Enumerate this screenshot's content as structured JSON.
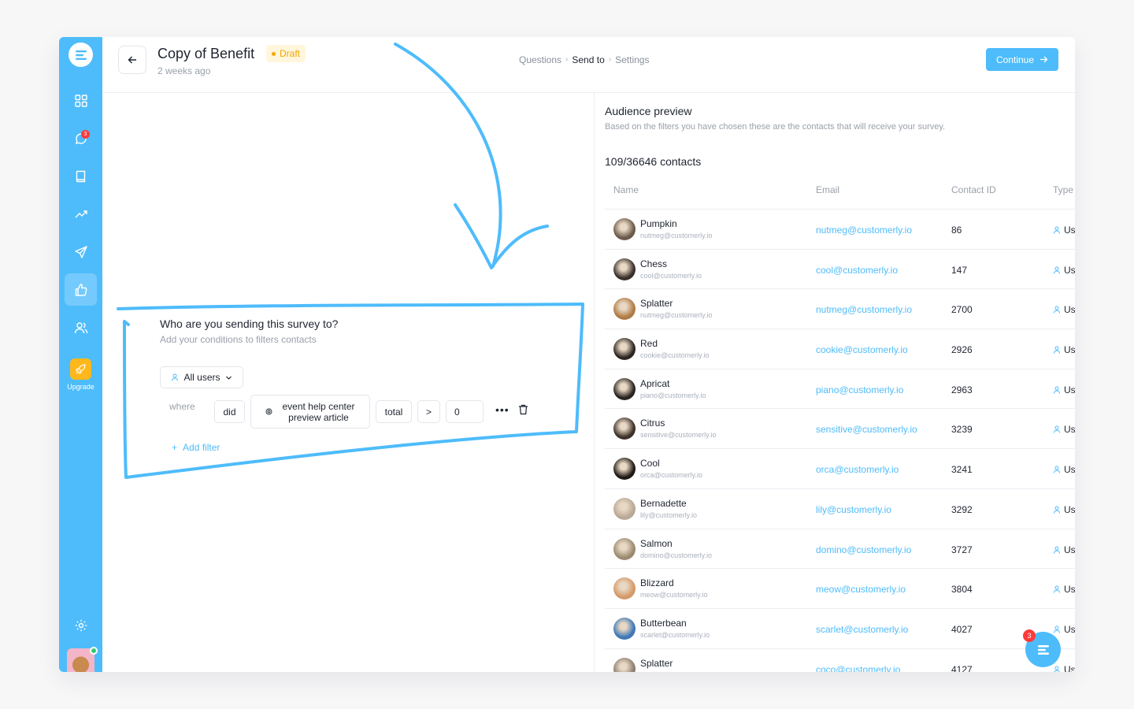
{
  "header": {
    "title": "Copy of Benefit",
    "status": "Draft",
    "subtitle": "2 weeks ago",
    "crumbs": [
      "Questions",
      "Send to",
      "Settings"
    ],
    "continue_label": "Continue"
  },
  "sidebar": {
    "badge": "3",
    "upgrade_label": "Upgrade",
    "items": [
      "grid-icon",
      "chat-icon",
      "book-icon",
      "trending-icon",
      "send-icon",
      "thumbs-up-icon",
      "users-icon"
    ]
  },
  "filter": {
    "title": "Who are you sending this survey to?",
    "subtitle": "Add your conditions to filters contacts",
    "audience": "All users",
    "where_label": "where",
    "verb": "did",
    "event_line1": "event help center",
    "event_line2": "preview article",
    "aggregate": "total",
    "operator": ">",
    "value": "0",
    "add_filter": "Add filter"
  },
  "audience": {
    "title": "Audience preview",
    "subtitle": "Based on the filters you have chosen these are the contacts that will receive your survey.",
    "count": "109/36646 contacts",
    "columns": [
      "Name",
      "Email",
      "Contact ID",
      "Type"
    ],
    "type_label": "Us",
    "rows": [
      {
        "name": "Pumpkin",
        "sub": "nutmeg@customerly.io",
        "email": "nutmeg@customerly.io",
        "id": "86",
        "color": "#6b5a4a"
      },
      {
        "name": "Chess",
        "sub": "cool@customerly.io",
        "email": "cool@customerly.io",
        "id": "147",
        "color": "#3a2f2a"
      },
      {
        "name": "Splatter",
        "sub": "nutmeg@customerly.io",
        "email": "nutmeg@customerly.io",
        "id": "2700",
        "color": "#b07a45"
      },
      {
        "name": "Red",
        "sub": "cookie@customerly.io",
        "email": "cookie@customerly.io",
        "id": "2926",
        "color": "#2d2520"
      },
      {
        "name": "Apricat",
        "sub": "piano@customerly.io",
        "email": "piano@customerly.io",
        "id": "2963",
        "color": "#2a2420"
      },
      {
        "name": "Citrus",
        "sub": "sensitive@customerly.io",
        "email": "sensitive@customerly.io",
        "id": "3239",
        "color": "#3c3128"
      },
      {
        "name": "Cool",
        "sub": "orca@customerly.io",
        "email": "orca@customerly.io",
        "id": "3241",
        "color": "#201a15"
      },
      {
        "name": "Bernadette",
        "sub": "lily@customerly.io",
        "email": "lily@customerly.io",
        "id": "3292",
        "color": "#b9a896"
      },
      {
        "name": "Salmon",
        "sub": "domino@customerly.io",
        "email": "domino@customerly.io",
        "id": "3727",
        "color": "#9b8a70"
      },
      {
        "name": "Blizzard",
        "sub": "meow@customerly.io",
        "email": "meow@customerly.io",
        "id": "3804",
        "color": "#d49a6a"
      },
      {
        "name": "Butterbean",
        "sub": "scarlet@customerly.io",
        "email": "scarlet@customerly.io",
        "id": "4027",
        "color": "#3f78b5"
      },
      {
        "name": "Splatter",
        "sub": "coco@customerly.io",
        "email": "coco@customerly.io",
        "id": "4127",
        "color": "#8c7e70"
      }
    ]
  },
  "chat_badge": "3",
  "colors": {
    "accent": "#4ebcfb",
    "draft": "#f4a800",
    "badge": "#ff3b3b"
  }
}
